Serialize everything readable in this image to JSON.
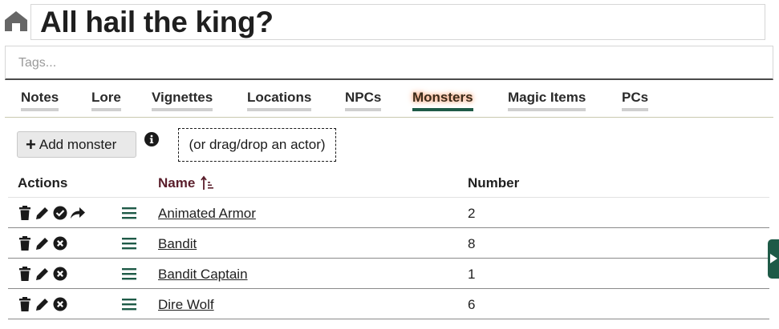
{
  "header": {
    "home_icon": "home-icon",
    "title": "All hail the king?"
  },
  "tags": {
    "placeholder": "Tags..."
  },
  "tabs": [
    {
      "label": "Notes",
      "active": false
    },
    {
      "label": "Lore",
      "active": false
    },
    {
      "label": "Vignettes",
      "active": false
    },
    {
      "label": "Locations",
      "active": false
    },
    {
      "label": "NPCs",
      "active": false
    },
    {
      "label": "Monsters",
      "active": true
    },
    {
      "label": "Magic Items",
      "active": false
    },
    {
      "label": "PCs",
      "active": false
    }
  ],
  "toolbar": {
    "add_label": "Add monster",
    "add_icon": "plus-icon",
    "info_icon": "info-icon",
    "drop_hint": "(or drag/drop an actor)"
  },
  "table": {
    "headers": {
      "actions": "Actions",
      "name": "Name",
      "number": "Number"
    },
    "sort": "ascending",
    "rows": [
      {
        "name": "Animated Armor",
        "number": "2",
        "actions": [
          "trash-icon",
          "pencil-icon",
          "check-circle-icon",
          "share-icon"
        ]
      },
      {
        "name": "Bandit",
        "number": "8",
        "actions": [
          "trash-icon",
          "pencil-icon",
          "x-circle-icon"
        ]
      },
      {
        "name": "Bandit Captain",
        "number": "1",
        "actions": [
          "trash-icon",
          "pencil-icon",
          "x-circle-icon"
        ]
      },
      {
        "name": "Dire Wolf",
        "number": "6",
        "actions": [
          "trash-icon",
          "pencil-icon",
          "x-circle-icon"
        ]
      }
    ]
  },
  "colors": {
    "accent": "#1e5a47",
    "name_header": "#5a1e2b",
    "active_glow": "#ff9a6a"
  }
}
